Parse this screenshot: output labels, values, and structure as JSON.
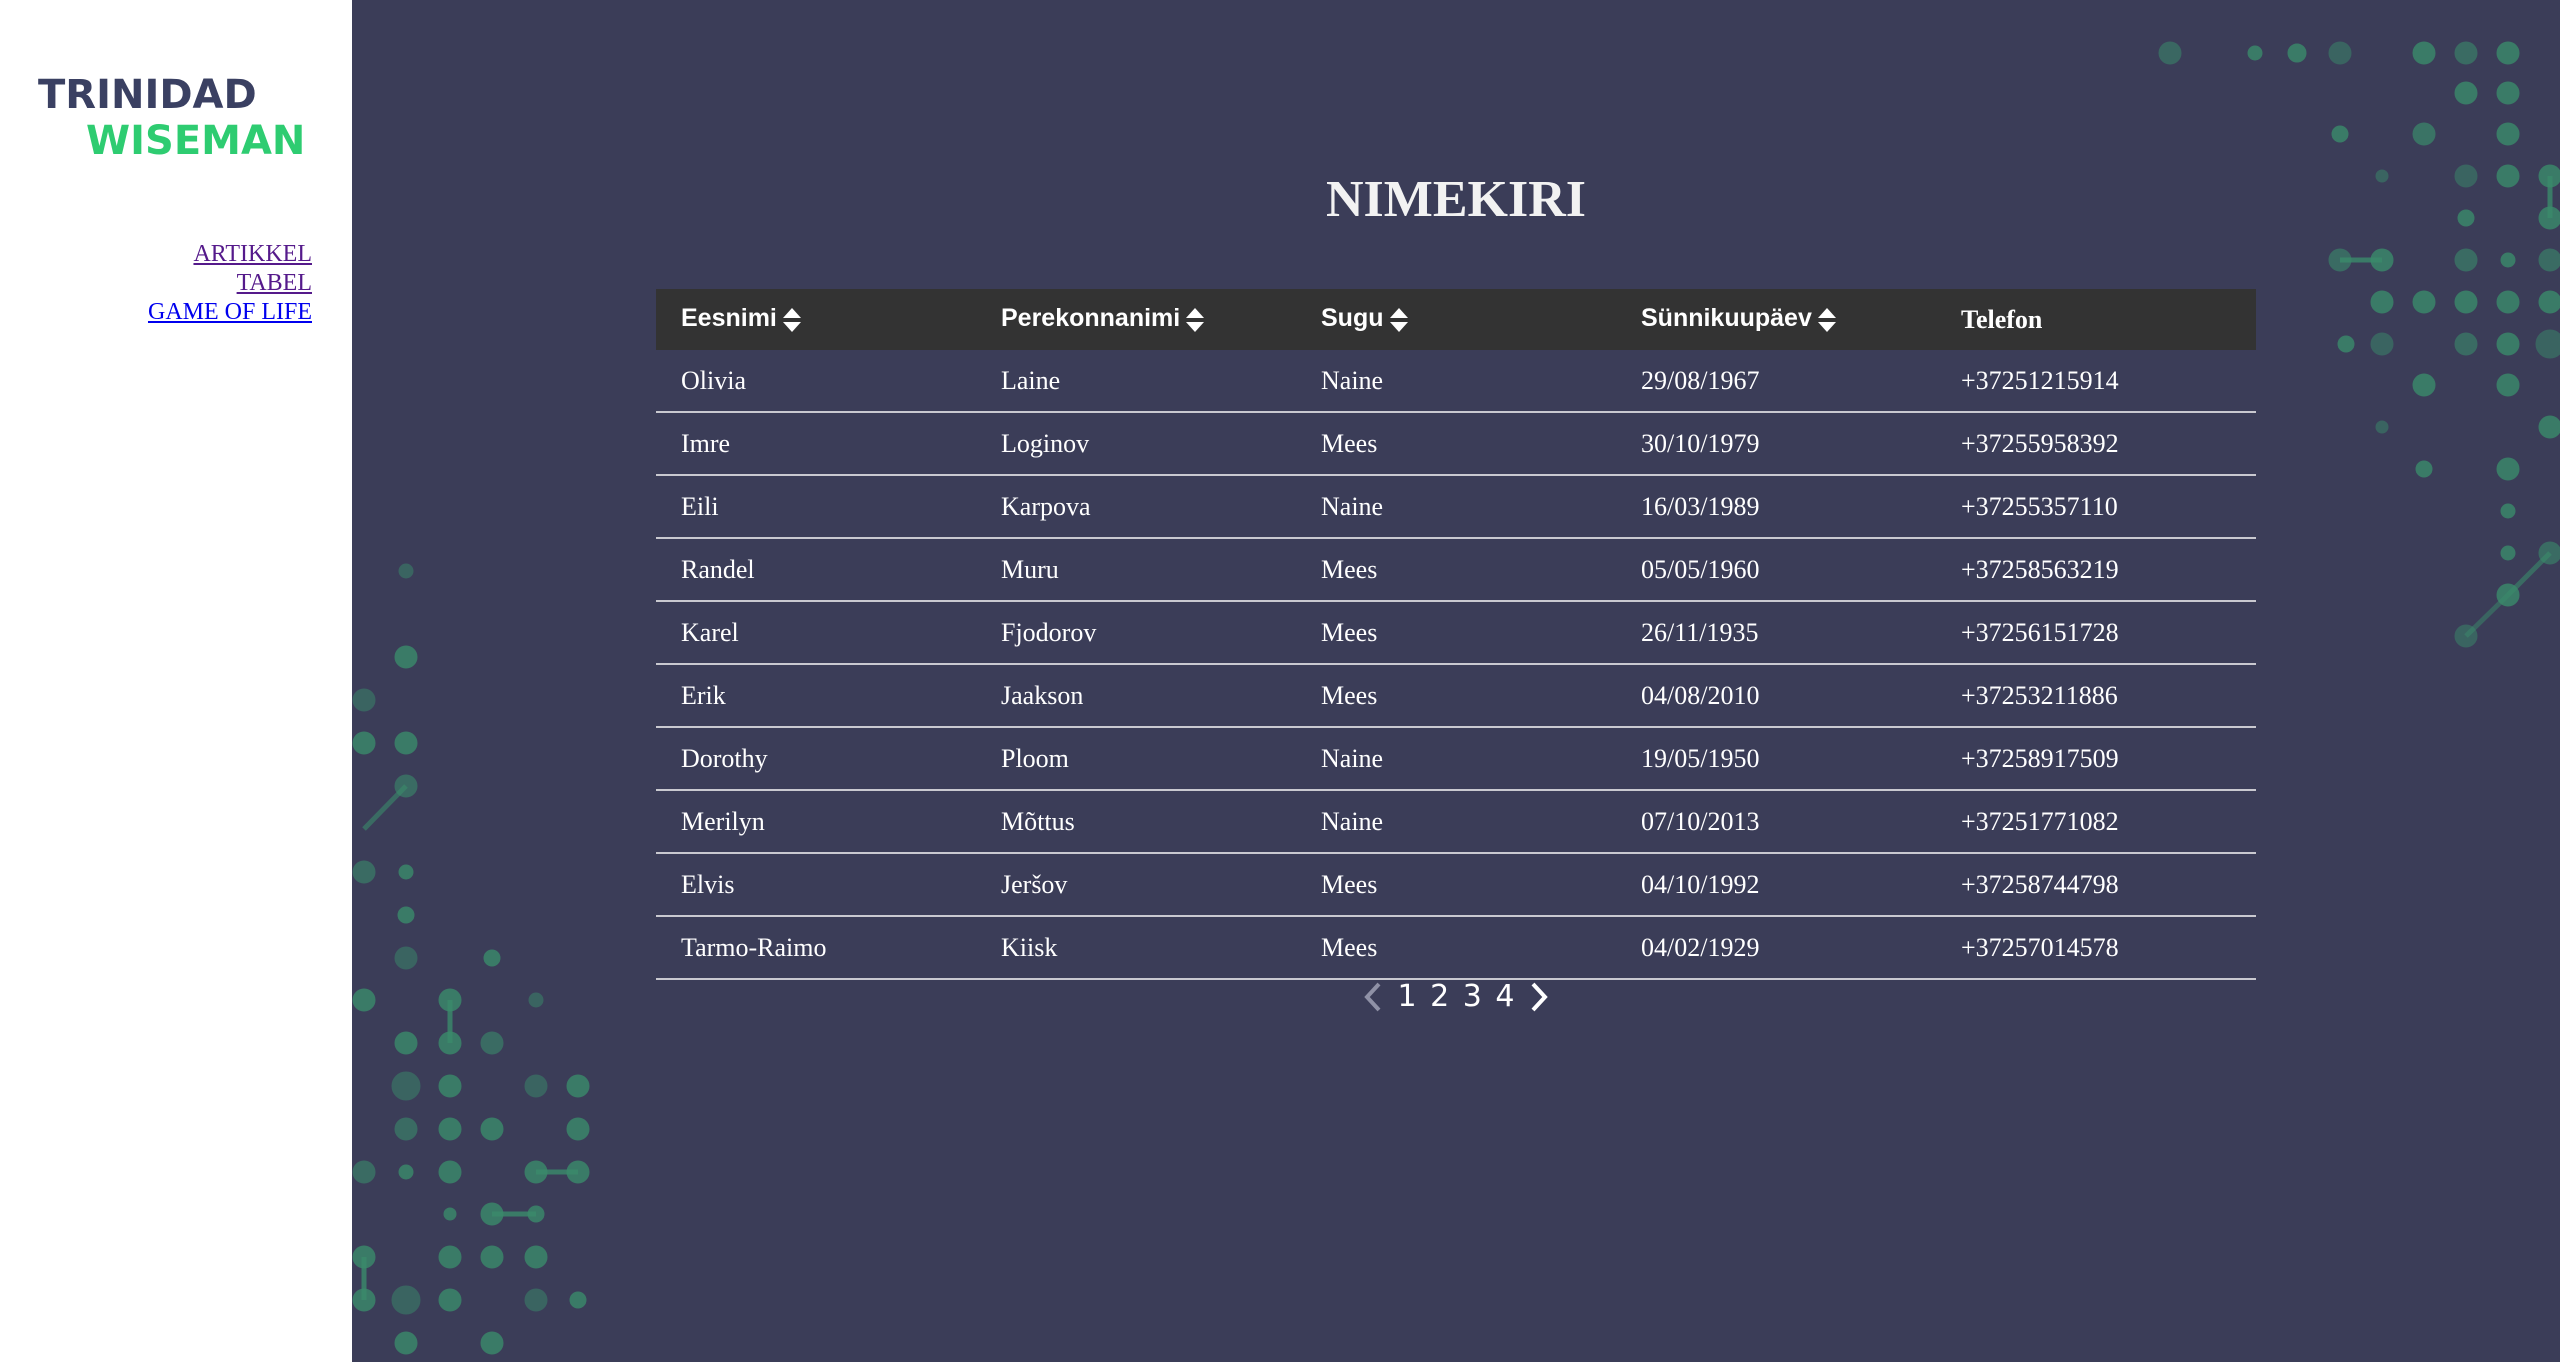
{
  "logo": {
    "line1": "TRINIDAD",
    "line2": "WISEMAN",
    "color_dark": "#3a4062",
    "color_green": "#2ecc71"
  },
  "nav": {
    "items": [
      {
        "label": "ARTIKKEL",
        "state": "visited"
      },
      {
        "label": "TABEL",
        "state": "visited"
      },
      {
        "label": "GAME OF LIFE",
        "state": "unvisited"
      }
    ]
  },
  "page": {
    "title": "NIMEKIRI"
  },
  "table": {
    "columns": [
      {
        "label": "Eesnimi",
        "sortable": true
      },
      {
        "label": "Perekonnanimi",
        "sortable": true
      },
      {
        "label": "Sugu",
        "sortable": true
      },
      {
        "label": "Sünnikuupäev",
        "sortable": true
      },
      {
        "label": "Telefon",
        "sortable": false
      }
    ],
    "rows": [
      [
        "Olivia",
        "Laine",
        "Naine",
        "29/08/1967",
        "+37251215914"
      ],
      [
        "Imre",
        "Loginov",
        "Mees",
        "30/10/1979",
        "+37255958392"
      ],
      [
        "Eili",
        "Karpova",
        "Naine",
        "16/03/1989",
        "+37255357110"
      ],
      [
        "Randel",
        "Muru",
        "Mees",
        "05/05/1960",
        "+37258563219"
      ],
      [
        "Karel",
        "Fjodorov",
        "Mees",
        "26/11/1935",
        "+37256151728"
      ],
      [
        "Erik",
        "Jaakson",
        "Mees",
        "04/08/2010",
        "+37253211886"
      ],
      [
        "Dorothy",
        "Ploom",
        "Naine",
        "19/05/1950",
        "+37258917509"
      ],
      [
        "Merilyn",
        "Mõttus",
        "Naine",
        "07/10/2013",
        "+37251771082"
      ],
      [
        "Elvis",
        "Jeršov",
        "Mees",
        "04/10/1992",
        "+37258744798"
      ],
      [
        "Tarmo-Raimo",
        "Kiisk",
        "Mees",
        "04/02/1929",
        "+37257014578"
      ]
    ]
  },
  "pagination": {
    "pages": [
      "1",
      "2",
      "3",
      "4"
    ],
    "prev_icon": "chevron-left-icon",
    "next_icon": "chevron-right-icon"
  },
  "colors": {
    "background": "#3b3d58",
    "header_bg": "#333333",
    "dot_green": "#3a8b6b",
    "sidebar_bg": "#ffffff"
  }
}
